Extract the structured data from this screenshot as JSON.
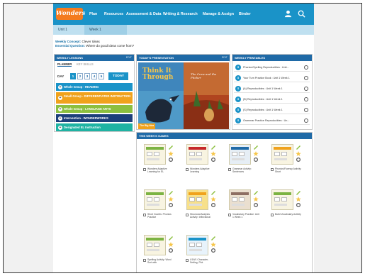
{
  "header": {
    "logo": "Wonders",
    "nav": [
      "Plan",
      "Resources",
      "Assessment & Data",
      "Writing & Research",
      "Manage & Assign",
      "Binder"
    ]
  },
  "unitbar": {
    "unit": "Unit 1",
    "week": "Week 1"
  },
  "concept": {
    "label": "Weekly Concept:",
    "value": "Clever Ideas",
    "q_label": "Essential Question:",
    "q_value": "Where do good ideas come from?"
  },
  "lessons": {
    "heading": "WEEKLY LESSONS",
    "edit": "EDIT",
    "tabs": [
      "PLANNER",
      "KEY SKILLS"
    ],
    "day_label": "DAY",
    "days": [
      "1",
      "2",
      "3",
      "4",
      "5"
    ],
    "today": "TODAY",
    "items": [
      {
        "label": "Whole Group - READING",
        "color": "#1a93c8"
      },
      {
        "label": "Small Group - DIFFERENTIATED INSTRUCTION",
        "color": "#f0a21c"
      },
      {
        "label": "Whole Group - LANGUAGE ARTS",
        "color": "#8cbf3f"
      },
      {
        "label": "Intervention - WONDERWORKS",
        "color": "#1c3f7a"
      },
      {
        "label": "Designated EL Instruction",
        "color": "#1fb3a3"
      }
    ]
  },
  "presentation": {
    "heading": "TODAY'S PRESENTATION",
    "edit": "EDIT",
    "cover_title": "Think It Through",
    "cover_sub": "The Crow and the Pitcher",
    "cover_badge": "The Big Idea"
  },
  "printables": {
    "heading": "WEEKLY PRINTABLES",
    "items": [
      "Phonics/Spelling Reproducibles : Unit...",
      "Your Turn Practice Book : Unit 1 Week 1",
      "(A) Reproducibles : Unit 1 Week 1",
      "(B) Reproducibles : Unit 1 Week 1",
      "(S) Reproducibles : Unit 1 Week 1",
      "Grammar Practice Reproducibles : Un..."
    ]
  },
  "games": {
    "heading": "THIS WEEK'S GAMES",
    "items": [
      "Wonders Adaptive Learning for EL",
      "Wonders Adaptive Learning",
      "Grammar Activity: Sentences",
      "Phonics/Fluency Activity: Short",
      "Short Vowels: Phonics Practice",
      "Structural Analysis Activity: Inflectional",
      "Vocabulary Practice: Unit 1 Week 1",
      "Build Vocabulary Activity",
      "Spelling Activity: Word Sort with",
      "U1W1 Character, Setting, Plot"
    ]
  }
}
